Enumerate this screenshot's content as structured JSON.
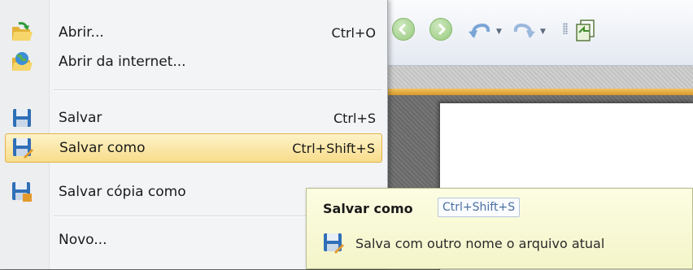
{
  "menu": {
    "items": [
      {
        "label": "Abrir...",
        "shortcut": "Ctrl+O",
        "icon": "folder-open-icon"
      },
      {
        "label": "Abrir da internet...",
        "shortcut": "",
        "icon": "globe-folder-icon"
      },
      {
        "label": "Salvar",
        "shortcut": "Ctrl+S",
        "icon": "floppy-disk-icon"
      },
      {
        "label": "Salvar como",
        "shortcut": "Ctrl+Shift+S",
        "icon": "floppy-disk-save-as-icon",
        "highlighted": true
      },
      {
        "label": "Salvar cópia como",
        "shortcut": "",
        "icon": "floppy-disk-copy-icon"
      },
      {
        "label": "Novo...",
        "shortcut": "",
        "icon": ""
      }
    ]
  },
  "tooltip": {
    "title": "Salvar como",
    "shortcut": "Ctrl+Shift+S",
    "description": "Salva com outro nome o arquivo atual",
    "icon": "floppy-disk-save-as-icon"
  },
  "toolbar": {
    "icons": [
      "back-icon",
      "forward-icon",
      "undo-icon",
      "redo-icon",
      "copy-page-icon"
    ]
  },
  "colors": {
    "highlight": "#f8dc8a",
    "highlight_border": "#e4b14c",
    "tooltip_bg": "#f4f5c9",
    "accent_strip": "#d89a2a"
  }
}
